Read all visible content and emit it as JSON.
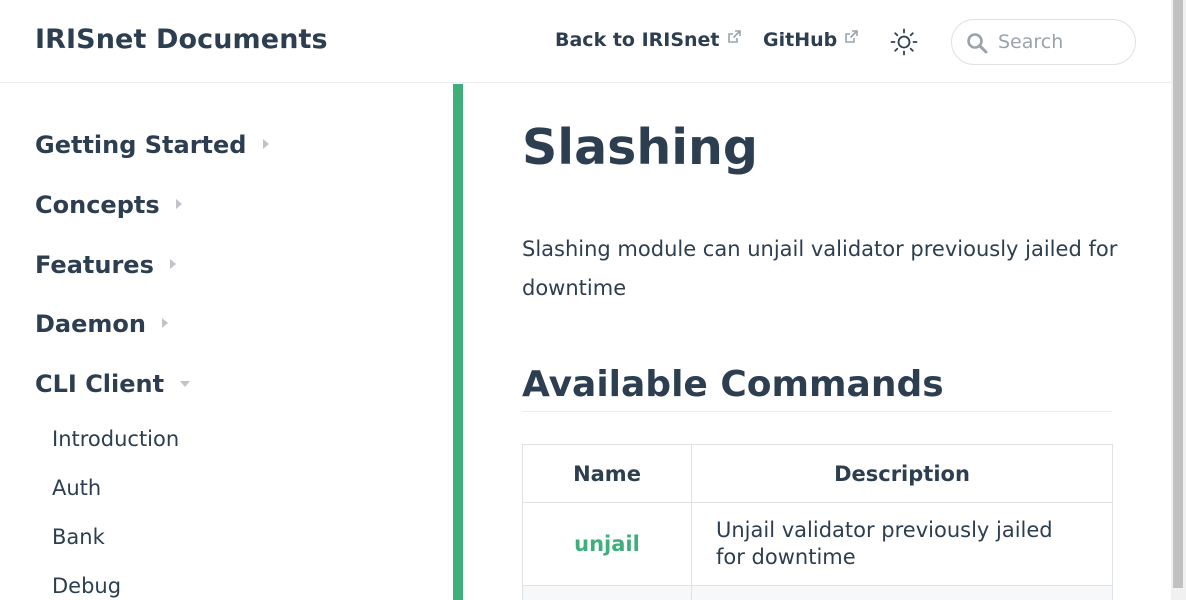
{
  "navbar": {
    "site_name": "IRISnet Documents",
    "links": [
      {
        "label": "Back to IRISnet",
        "icon": "external-link-icon"
      },
      {
        "label": "GitHub",
        "icon": "external-link-icon"
      }
    ],
    "theme_icon": "sun-icon",
    "search": {
      "placeholder": "Search",
      "value": "",
      "icon": "search-icon"
    }
  },
  "sidebar": {
    "groups": [
      {
        "label": "Getting Started",
        "expanded": false
      },
      {
        "label": "Concepts",
        "expanded": false
      },
      {
        "label": "Features",
        "expanded": false
      },
      {
        "label": "Daemon",
        "expanded": false
      },
      {
        "label": "CLI Client",
        "expanded": true
      }
    ],
    "items": [
      "Introduction",
      "Auth",
      "Bank",
      "Debug"
    ]
  },
  "content": {
    "title": "Slashing",
    "intro": "Slashing module can unjail validator previously jailed for downtime",
    "section_heading": "Available Commands",
    "table": {
      "headers": [
        "Name",
        "Description"
      ],
      "rows": [
        {
          "name": "unjail",
          "description": "Unjail validator previously jailed for downtime"
        }
      ]
    }
  },
  "colors": {
    "accent": "#3eaf7c",
    "text": "#2c3e50",
    "border": "#eaecef"
  }
}
